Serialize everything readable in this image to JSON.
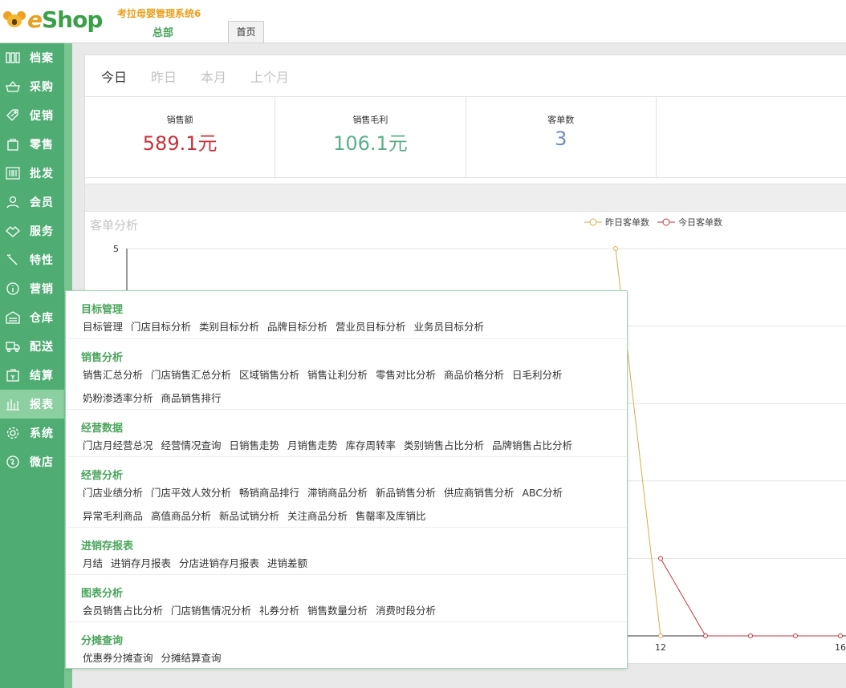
{
  "header": {
    "logo_text_e": "e",
    "logo_text_shop": "Shop",
    "system_name": "考拉母婴管理系统6",
    "branch": "总部",
    "tab_home": "首页"
  },
  "sidebar": {
    "items": [
      {
        "label": "档案",
        "icon": "archive-icon"
      },
      {
        "label": "采购",
        "icon": "basket-icon"
      },
      {
        "label": "促销",
        "icon": "tag-icon"
      },
      {
        "label": "零售",
        "icon": "bag-icon"
      },
      {
        "label": "批发",
        "icon": "barcode-icon"
      },
      {
        "label": "会员",
        "icon": "user-icon"
      },
      {
        "label": "服务",
        "icon": "handshake-icon"
      },
      {
        "label": "特性",
        "icon": "wand-icon"
      },
      {
        "label": "营销",
        "icon": "info-icon"
      },
      {
        "label": "仓库",
        "icon": "warehouse-icon"
      },
      {
        "label": "配送",
        "icon": "truck-icon"
      },
      {
        "label": "结算",
        "icon": "wallet-icon"
      },
      {
        "label": "报表",
        "icon": "bar-chart-icon"
      },
      {
        "label": "系统",
        "icon": "gear-icon"
      },
      {
        "label": "微店",
        "icon": "shop-icon"
      }
    ],
    "active_index": 12
  },
  "period_tabs": [
    "今日",
    "昨日",
    "本月",
    "上个月"
  ],
  "kpis": [
    {
      "label": "销售额",
      "value": "589.1元",
      "color": "#c9303a"
    },
    {
      "label": "销售毛利",
      "value": "106.1元",
      "color": "#5aaf88"
    },
    {
      "label": "客单数",
      "value": "3",
      "color": "#6b8fb5"
    }
  ],
  "chart_data": {
    "type": "line",
    "title": "客单分析",
    "x_ticks": [
      "12",
      "16"
    ],
    "y_ticks": [
      "5"
    ],
    "series": [
      {
        "name": "昨日客单数",
        "color": "#d4ae48",
        "x": [
          11,
          12
        ],
        "values": [
          5,
          0
        ]
      },
      {
        "name": "今日客单数",
        "color": "#c4353e",
        "x": [
          12,
          13,
          14,
          15,
          16
        ],
        "values": [
          1,
          0,
          0,
          0,
          0
        ]
      }
    ],
    "legend_position": "top-right"
  },
  "dropdown": {
    "groups": [
      {
        "title": "目标管理",
        "links": [
          "目标管理",
          "门店目标分析",
          "类别目标分析",
          "品牌目标分析",
          "营业员目标分析",
          "业务员目标分析"
        ]
      },
      {
        "title": "销售分析",
        "links": [
          "销售汇总分析",
          "门店销售汇总分析",
          "区域销售分析",
          "销售让利分析",
          "零售对比分析",
          "商品价格分析",
          "日毛利分析",
          "奶粉渗透率分析",
          "商品销售排行"
        ]
      },
      {
        "title": "经营数据",
        "links": [
          "门店月经营总况",
          "经营情况查询",
          "日销售走势",
          "月销售走势",
          "库存周转率",
          "类别销售占比分析",
          "品牌销售占比分析"
        ]
      },
      {
        "title": "经营分析",
        "links": [
          "门店业绩分析",
          "门店平效人效分析",
          "畅销商品排行",
          "滞销商品分析",
          "新品销售分析",
          "供应商销售分析",
          "ABC分析",
          "异常毛利商品",
          "高值商品分析",
          "新品试销分析",
          "关注商品分析",
          "售罄率及库销比"
        ]
      },
      {
        "title": "进销存报表",
        "links": [
          "月结",
          "进销存月报表",
          "分店进销存月报表",
          "进销差额"
        ]
      },
      {
        "title": "图表分析",
        "links": [
          "会员销售占比分析",
          "门店销售情况分析",
          "礼券分析",
          "销售数量分析",
          "消费时段分析"
        ]
      },
      {
        "title": "分摊查询",
        "links": [
          "优惠券分摊查询",
          "分摊结算查询"
        ]
      }
    ]
  }
}
